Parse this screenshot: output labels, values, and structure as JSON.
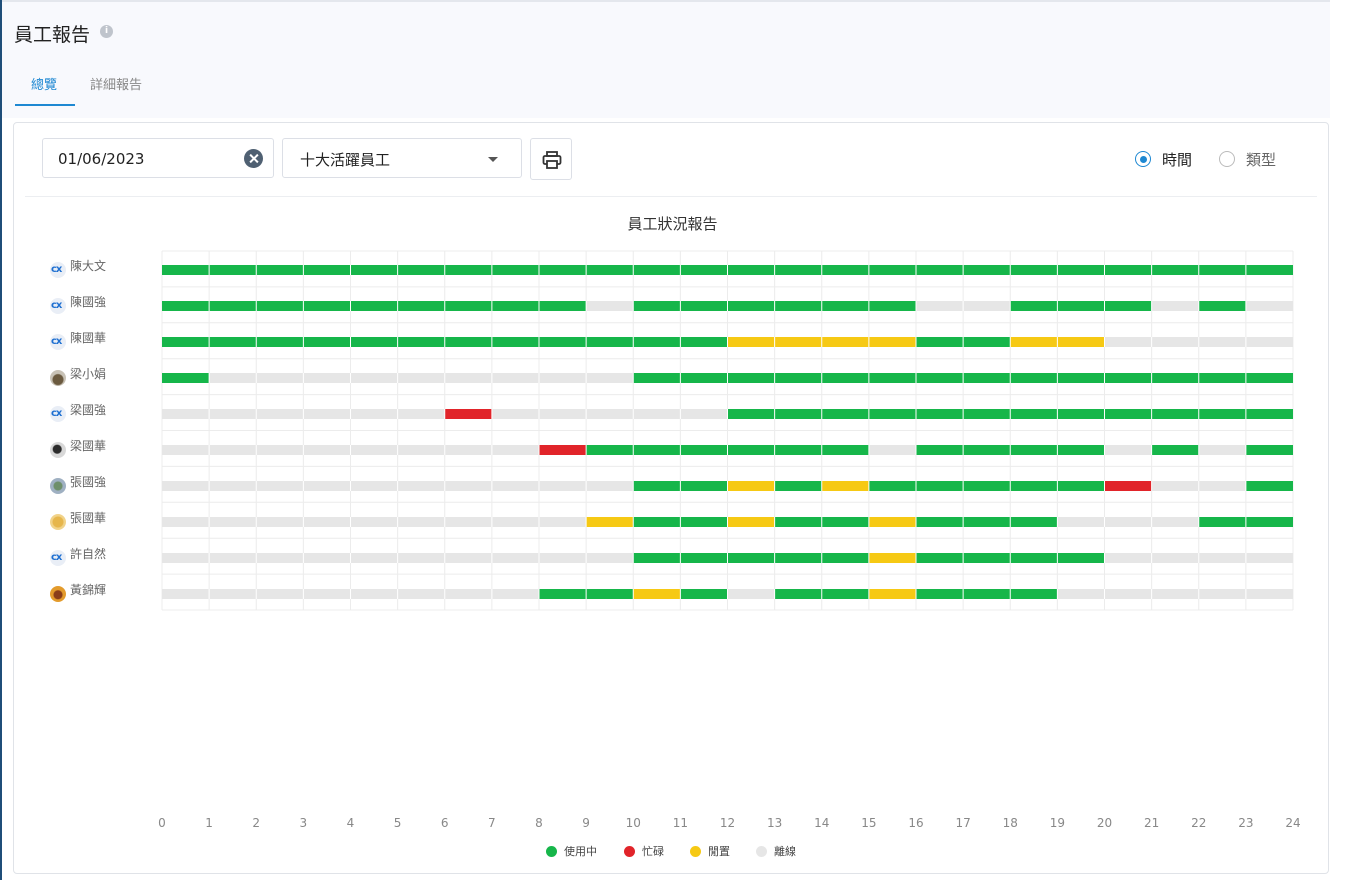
{
  "page": {
    "title": "員工報告"
  },
  "tabs": [
    {
      "label": "總覽",
      "active": true
    },
    {
      "label": "詳細報告",
      "active": false
    }
  ],
  "filters": {
    "date": "01/06/2023",
    "employee_group": "十大活躍員工",
    "view_options": [
      {
        "label": "時間",
        "checked": true
      },
      {
        "label": "類型",
        "checked": false
      }
    ]
  },
  "colors": {
    "active": "#16b64a",
    "busy": "#e1242a",
    "idle": "#f6c914",
    "offline": "#e6e6e6",
    "accent": "#1e88d2"
  },
  "chart_data": {
    "type": "timeline",
    "title": "員工狀況報告",
    "x_ticks": [
      "0",
      "1",
      "2",
      "3",
      "4",
      "5",
      "6",
      "7",
      "8",
      "9",
      "10",
      "11",
      "12",
      "13",
      "14",
      "15",
      "16",
      "17",
      "18",
      "19",
      "20",
      "21",
      "22",
      "23",
      "24"
    ],
    "xlim": [
      0,
      24
    ],
    "grid": true,
    "legend": [
      {
        "key": "active",
        "label": "使用中"
      },
      {
        "key": "busy",
        "label": "忙碌"
      },
      {
        "key": "idle",
        "label": "閒置"
      },
      {
        "key": "offline",
        "label": "離線"
      }
    ],
    "legend_placement": "bottom",
    "rows": [
      {
        "name": "陳大文",
        "avatar": "logo",
        "segments": [
          [
            0,
            24,
            "active"
          ]
        ]
      },
      {
        "name": "陳國強",
        "avatar": "logo",
        "segments": [
          [
            0,
            9,
            "active"
          ],
          [
            9,
            10,
            "offline"
          ],
          [
            10,
            16,
            "active"
          ],
          [
            16,
            18,
            "offline"
          ],
          [
            18,
            21,
            "active"
          ],
          [
            21,
            22,
            "offline"
          ],
          [
            22,
            23,
            "active"
          ],
          [
            23,
            24,
            "offline"
          ]
        ]
      },
      {
        "name": "陳國華",
        "avatar": "logo",
        "segments": [
          [
            0,
            12,
            "active"
          ],
          [
            12,
            16,
            "idle"
          ],
          [
            16,
            18,
            "active"
          ],
          [
            18,
            20,
            "idle"
          ],
          [
            20,
            24,
            "offline"
          ]
        ]
      },
      {
        "name": "梁小娟",
        "avatar": "photo1",
        "segments": [
          [
            0,
            1,
            "active"
          ],
          [
            1,
            10,
            "offline"
          ],
          [
            10,
            24,
            "active"
          ]
        ]
      },
      {
        "name": "梁國強",
        "avatar": "logo",
        "segments": [
          [
            0,
            6,
            "offline"
          ],
          [
            6,
            7,
            "busy"
          ],
          [
            7,
            12,
            "offline"
          ],
          [
            12,
            24,
            "active"
          ]
        ]
      },
      {
        "name": "梁國華",
        "avatar": "photo2",
        "segments": [
          [
            0,
            8,
            "offline"
          ],
          [
            8,
            9,
            "busy"
          ],
          [
            9,
            15,
            "active"
          ],
          [
            15,
            16,
            "offline"
          ],
          [
            16,
            20,
            "active"
          ],
          [
            20,
            21,
            "offline"
          ],
          [
            21,
            22,
            "active"
          ],
          [
            22,
            23,
            "offline"
          ],
          [
            23,
            24,
            "active"
          ]
        ]
      },
      {
        "name": "張國強",
        "avatar": "photo3",
        "segments": [
          [
            0,
            10,
            "offline"
          ],
          [
            10,
            12,
            "active"
          ],
          [
            12,
            13,
            "idle"
          ],
          [
            13,
            14,
            "active"
          ],
          [
            14,
            15,
            "idle"
          ],
          [
            15,
            20,
            "active"
          ],
          [
            20,
            21,
            "busy"
          ],
          [
            21,
            23,
            "offline"
          ],
          [
            23,
            24,
            "active"
          ]
        ]
      },
      {
        "name": "張國華",
        "avatar": "photo4",
        "segments": [
          [
            0,
            9,
            "offline"
          ],
          [
            9,
            10,
            "idle"
          ],
          [
            10,
            12,
            "active"
          ],
          [
            12,
            13,
            "idle"
          ],
          [
            13,
            15,
            "active"
          ],
          [
            15,
            16,
            "idle"
          ],
          [
            16,
            19,
            "active"
          ],
          [
            19,
            22,
            "offline"
          ],
          [
            22,
            24,
            "active"
          ]
        ]
      },
      {
        "name": "許自然",
        "avatar": "logo",
        "segments": [
          [
            0,
            10,
            "offline"
          ],
          [
            10,
            15,
            "active"
          ],
          [
            15,
            16,
            "idle"
          ],
          [
            16,
            20,
            "active"
          ],
          [
            20,
            24,
            "offline"
          ]
        ]
      },
      {
        "name": "黃錦輝",
        "avatar": "photo5",
        "segments": [
          [
            0,
            8,
            "offline"
          ],
          [
            8,
            10,
            "active"
          ],
          [
            10,
            11,
            "idle"
          ],
          [
            11,
            12,
            "active"
          ],
          [
            12,
            13,
            "offline"
          ],
          [
            13,
            15,
            "active"
          ],
          [
            15,
            16,
            "idle"
          ],
          [
            16,
            19,
            "active"
          ],
          [
            19,
            24,
            "offline"
          ]
        ]
      }
    ]
  }
}
